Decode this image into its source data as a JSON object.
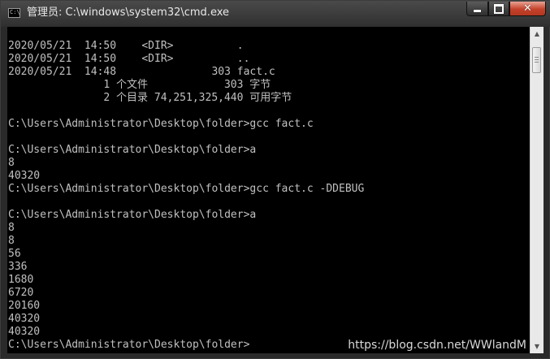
{
  "window": {
    "title": "管理员: C:\\windows\\system32\\cmd.exe",
    "icon_text": "C:\\"
  },
  "console": {
    "lines": [
      "",
      "2020/05/21  14:50    <DIR>          .",
      "2020/05/21  14:50    <DIR>          ..",
      "2020/05/21  14:48               303 fact.c",
      "               1 个文件            303 字节",
      "               2 个目录 74,251,325,440 可用字节",
      "",
      "C:\\Users\\Administrator\\Desktop\\folder>gcc fact.c",
      "",
      "C:\\Users\\Administrator\\Desktop\\folder>a",
      "8",
      "40320",
      "C:\\Users\\Administrator\\Desktop\\folder>gcc fact.c -DDEBUG",
      "",
      "C:\\Users\\Administrator\\Desktop\\folder>a",
      "8",
      "8",
      "56",
      "336",
      "1680",
      "6720",
      "20160",
      "40320",
      "40320",
      "C:\\Users\\Administrator\\Desktop\\folder>"
    ]
  },
  "watermark": "https://blog.csdn.net/WWlandM",
  "icons": {
    "minimize": "minimize-icon",
    "maximize": "maximize-icon",
    "close": "close-icon",
    "scroll_up": "arrow-up-icon",
    "scroll_down": "arrow-down-icon"
  },
  "colors": {
    "console_bg": "#000000",
    "console_fg": "#c0c0c0",
    "close_button": "#c4412a"
  }
}
